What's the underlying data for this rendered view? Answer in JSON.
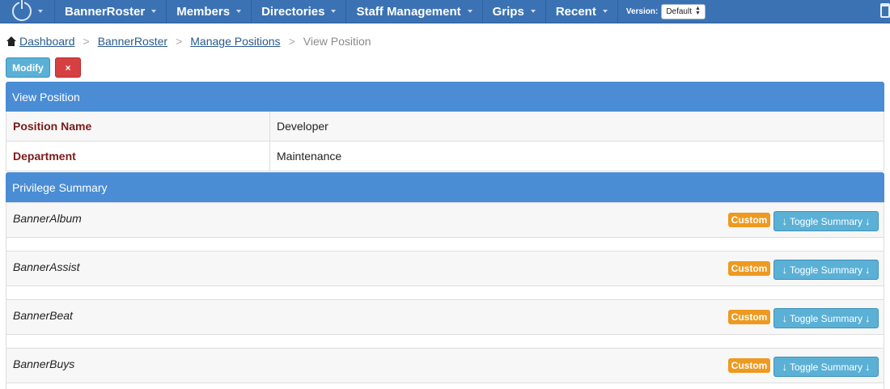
{
  "navbar": {
    "items": [
      {
        "label": "BannerRoster"
      },
      {
        "label": "Members"
      },
      {
        "label": "Directories"
      },
      {
        "label": "Staff Management"
      },
      {
        "label": "Grips"
      },
      {
        "label": "Recent"
      }
    ],
    "version_label": "Version:",
    "version_value": "Default"
  },
  "breadcrumb": {
    "items": [
      {
        "label": "Dashboard"
      },
      {
        "label": "BannerRoster"
      },
      {
        "label": "Manage Positions"
      }
    ],
    "current": "View Position",
    "separator": ">"
  },
  "actions": {
    "modify_label": "Modify",
    "delete_label": "×"
  },
  "view_position": {
    "heading": "View Position",
    "rows": [
      {
        "label": "Position Name",
        "value": "Developer"
      },
      {
        "label": "Department",
        "value": "Maintenance"
      }
    ]
  },
  "privilege_summary": {
    "heading": "Privilege Summary",
    "items": [
      {
        "name": "BannerAlbum",
        "badge": "Custom",
        "toggle_label": "Toggle Summary"
      },
      {
        "name": "BannerAssist",
        "badge": "Custom",
        "toggle_label": "Toggle Summary"
      },
      {
        "name": "BannerBeat",
        "badge": "Custom",
        "toggle_label": "Toggle Summary"
      },
      {
        "name": "BannerBuys",
        "badge": "Custom",
        "toggle_label": "Toggle Summary"
      }
    ],
    "toggle_arrow": "↓"
  },
  "colors": {
    "navbar": "#3b72b4",
    "panel_heading": "#4a8dd4",
    "label_text": "#7a1a1a",
    "badge": "#ee9920",
    "info_button": "#5bb0d6",
    "danger_button": "#d64040"
  }
}
